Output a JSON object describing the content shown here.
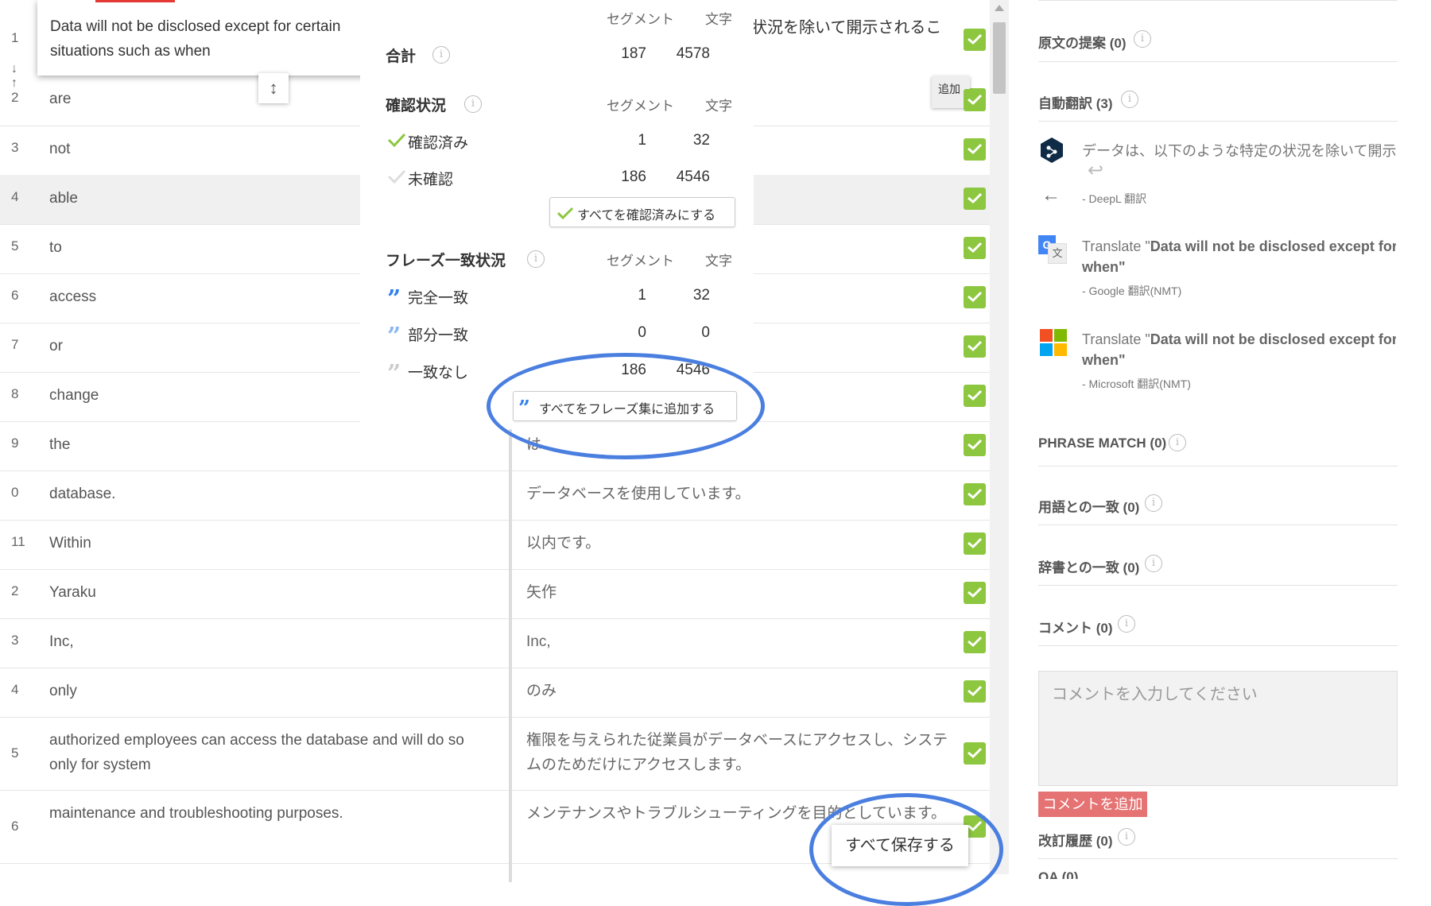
{
  "row1": {
    "num": "1",
    "source_popup": "Data will not be disclosed except for certain situations such as when",
    "target_visible": "状況を除いて開示されるこ",
    "add_chip": "追加"
  },
  "rows": [
    {
      "num": "2",
      "src": "are",
      "tgt": ""
    },
    {
      "num": "3",
      "src": "not",
      "tgt": ""
    },
    {
      "num": "4",
      "src": "able",
      "tgt": ""
    },
    {
      "num": "5",
      "src": "to",
      "tgt": ""
    },
    {
      "num": "6",
      "src": "access",
      "tgt": ""
    },
    {
      "num": "7",
      "src": "or",
      "tgt": ""
    },
    {
      "num": "8",
      "src": "change",
      "tgt": ""
    },
    {
      "num": "9",
      "src": "the",
      "tgt": "は"
    },
    {
      "num": "0",
      "src": "database.",
      "tgt": "データベースを使用しています。"
    },
    {
      "num": "11",
      "src": "Within",
      "tgt": "以内です。"
    },
    {
      "num": "2",
      "src": "Yaraku",
      "tgt": "矢作"
    },
    {
      "num": "3",
      "src": "Inc,",
      "tgt": "Inc,"
    },
    {
      "num": "4",
      "src": "only",
      "tgt": "のみ"
    },
    {
      "num": "5",
      "src": "authorized employees can access the database and will do so only for system",
      "tgt": "権限を与えられた従業員がデータベースにアクセスし、システムのためだけにアクセスします。"
    },
    {
      "num": "6",
      "src": "maintenance and troubleshooting purposes.",
      "tgt": "メンテナンスやトラブルシューティングを目的としています。"
    }
  ],
  "stats": {
    "col_segment": "セグメント",
    "col_chars": "文字",
    "total": {
      "label": "合計",
      "segments": "187",
      "chars": "4578"
    },
    "confirm_title": "確認状況",
    "confirmed": {
      "label": "確認済み",
      "segments": "1",
      "chars": "32"
    },
    "unconfirmed": {
      "label": "未確認",
      "segments": "186",
      "chars": "4546"
    },
    "confirm_all_btn": "すべてを確認済みにする",
    "phrase_title": "フレーズ一致状況",
    "exact": {
      "label": "完全一致",
      "segments": "1",
      "chars": "32"
    },
    "partial": {
      "label": "部分一致",
      "segments": "0",
      "chars": "0"
    },
    "none": {
      "label": "一致なし",
      "segments": "186",
      "chars": "4546"
    },
    "add_phrase_btn": "すべてをフレーズ集に追加する"
  },
  "save_all_btn": "すべて保存する",
  "right_panel": {
    "source_suggestions": "原文の提案 (0)",
    "auto_translation": "自動翻訳 (3)",
    "mt": [
      {
        "text": "データは、以下のような特定の状況を除いて開示されることはありません",
        "source": "- DeepL 翻訳",
        "icon": "deepl-icon"
      },
      {
        "prefix": "Translate \"",
        "bold": "Data will not be disclosed except for certain situations such as",
        "suffix": "when\"",
        "source": "- Google 翻訳(NMT)",
        "icon": "google-translate-icon"
      },
      {
        "prefix": "Translate \"",
        "bold": "Data will not be disclosed except for certain situations such as",
        "suffix": "when\"",
        "source": "- Microsoft 翻訳(NMT)",
        "icon": "microsoft-icon"
      }
    ],
    "phrase_match": "PHRASE MATCH (0)",
    "term_match": "用語との一致 (0)",
    "dict_match": "辞書との一致 (0)",
    "comments": "コメント (0)",
    "comment_placeholder": "コメントを入力してください",
    "comment_add": "コメントを追加",
    "revision_history": "改訂履歴 (0)",
    "qa": "QA (0)"
  },
  "colors": {
    "check": "#8dc63f",
    "accent_blue": "#4a7fe0",
    "comment_btn": "#e57373",
    "quote_blue": "#2f80ed"
  }
}
